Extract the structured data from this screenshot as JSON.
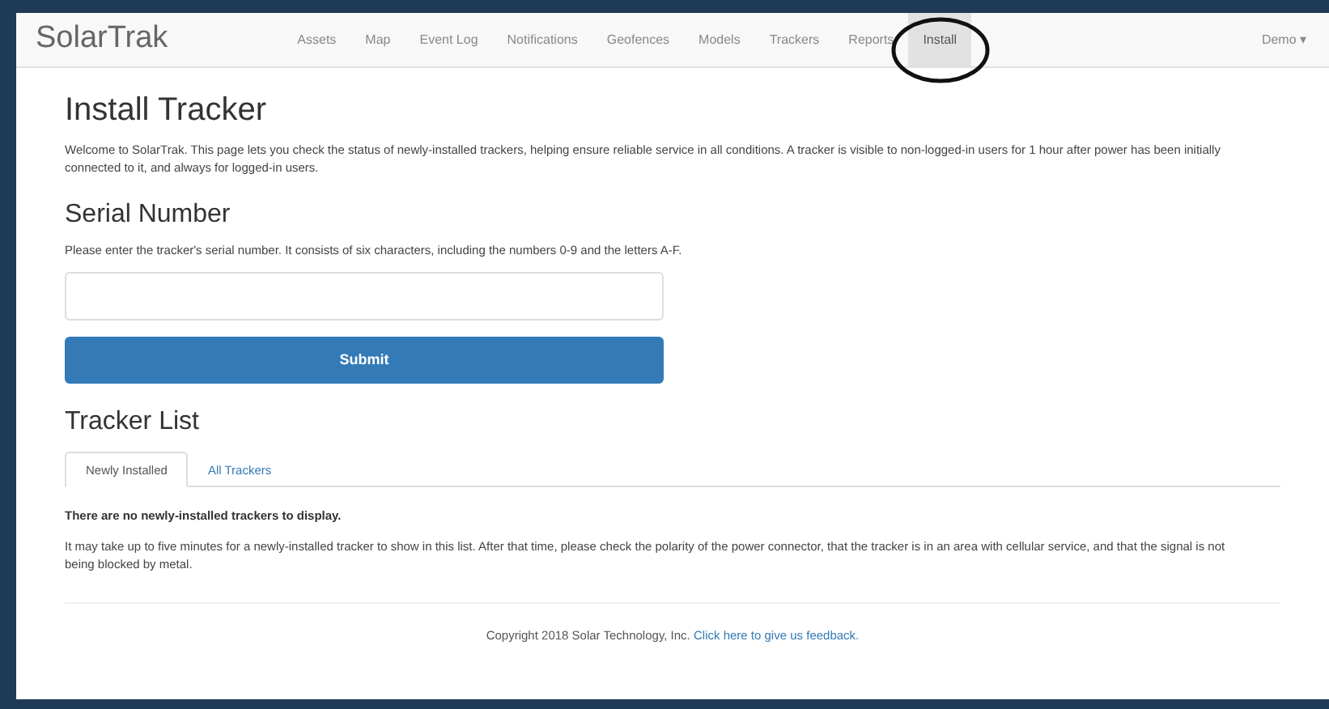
{
  "navbar": {
    "brand": "SolarTrak",
    "items": [
      {
        "label": "Assets",
        "selected": false
      },
      {
        "label": "Map",
        "selected": false
      },
      {
        "label": "Event Log",
        "selected": false
      },
      {
        "label": "Notifications",
        "selected": false
      },
      {
        "label": "Geofences",
        "selected": false
      },
      {
        "label": "Models",
        "selected": false
      },
      {
        "label": "Trackers",
        "selected": false
      },
      {
        "label": "Reports",
        "selected": false
      },
      {
        "label": "Install",
        "selected": true
      }
    ],
    "user_menu": "Demo ▾",
    "annotation": {
      "kind": "ellipse"
    }
  },
  "title": "Install Tracker",
  "intro": "Welcome to SolarTrak. This page lets you check the status of newly-installed trackers, helping ensure reliable service in all conditions. A tracker is visible to non-logged-in users for 1 hour after power has been initially connected to it, and always for logged-in users.",
  "serial": {
    "heading": "Serial Number",
    "help": "Please enter the tracker's serial number. It consists of six characters, including the numbers 0-9 and the letters A-F.",
    "submit": "Submit"
  },
  "tracker_list": {
    "heading": "Tracker List",
    "tabs": [
      {
        "label": "Newly Installed",
        "selected": true
      },
      {
        "label": "All Trackers",
        "selected": false
      }
    ],
    "empty_message": "There are no newly-installed trackers to display.",
    "note": "It may take up to five minutes for a newly-installed tracker to show in this list. After that time, please check the polarity of the power connector, that the tracker is in an area with cellular service, and that the signal is not being blocked by metal."
  },
  "footer": {
    "text": "Copyright 2018 Solar Technology, Inc.",
    "link": "Click here to give us feedback."
  }
}
